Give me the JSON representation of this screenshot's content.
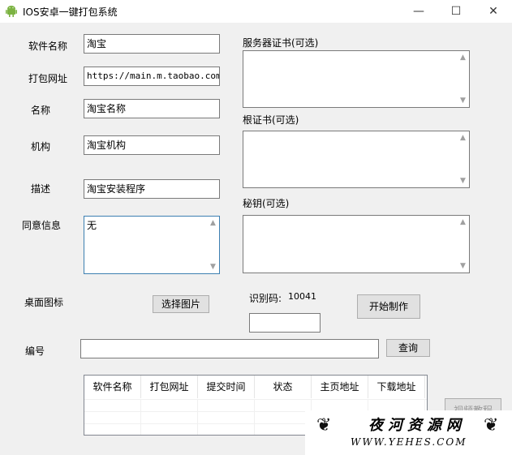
{
  "window": {
    "title": "IOS安卓一键打包系统",
    "controls": {
      "minimize": "—",
      "maximize": "☐",
      "close": "✕"
    }
  },
  "form": {
    "software_name": {
      "label": "软件名称",
      "value": "淘宝"
    },
    "package_url": {
      "label": "打包网址",
      "value": "https://main.m.taobao.com/"
    },
    "name": {
      "label": "名称",
      "value": "淘宝名称"
    },
    "org": {
      "label": "机构",
      "value": "淘宝机构"
    },
    "desc": {
      "label": "描述",
      "value": "淘宝安装程序"
    },
    "consent": {
      "label": "同意信息",
      "value": "无"
    },
    "desktop_icon": {
      "label": "桌面图标"
    },
    "number": {
      "label": "编号",
      "value": ""
    }
  },
  "right": {
    "server_cert": {
      "label": "服务器证书(可选)"
    },
    "root_cert": {
      "label": "根证书(可选)"
    },
    "secret_key": {
      "label": "秘钥(可选)"
    },
    "id_code": {
      "label": "识别码:",
      "value": "10041"
    },
    "id_input": ""
  },
  "buttons": {
    "choose_image": "选择图片",
    "start": "开始制作",
    "query": "查询",
    "video_tutorial": "视频教程"
  },
  "table": {
    "columns": [
      "软件名称",
      "打包网址",
      "提交时间",
      "状态",
      "主页地址",
      "下载地址"
    ]
  },
  "watermark": {
    "text": "夜河资源网",
    "url": "WWW.YEHES.COM"
  }
}
